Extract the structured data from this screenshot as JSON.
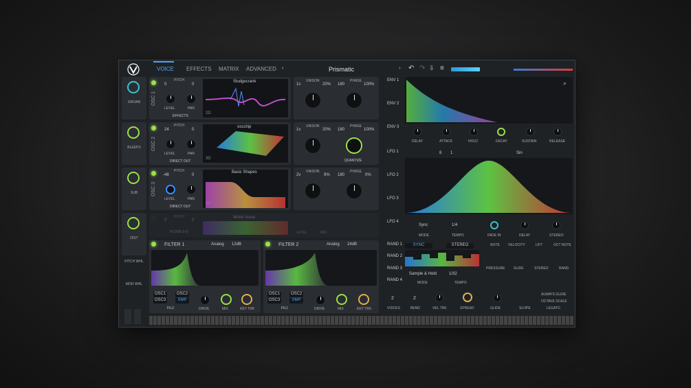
{
  "header": {
    "tabs": [
      "VOICE",
      "EFFECTS",
      "MATRIX",
      "ADVANCED"
    ],
    "preset": "Prismatic"
  },
  "sidebar": [
    "GROAN",
    "BLEEPS",
    "SUB",
    "DIST",
    "PITCH WHL",
    "MOD WHL"
  ],
  "osc1": {
    "name": "OSC 1",
    "wave": "Sludgecrank",
    "pitch_l": "0",
    "pitch_r": "0",
    "dest": "EFFECTS",
    "dim": "2D",
    "voices": "1v",
    "unison_pct": "20%",
    "phase_val": "180",
    "phase_pct": "100%"
  },
  "osc2": {
    "name": "OSC 2",
    "wave": "oscchip",
    "pitch_l": "24",
    "pitch_r": "0",
    "dest": "DIRECT OUT",
    "dim": "3D",
    "voices": "1v",
    "unison_pct": "20%",
    "phase_val": "180",
    "phase_pct": "100%",
    "extra": "QUANTIZE"
  },
  "osc3": {
    "name": "OSC 3",
    "wave": "Basic Shapes",
    "pitch_l": "-48",
    "pitch_r": "0",
    "dest": "DIRECT OUT",
    "dim": "2D",
    "voices": "2v",
    "unison_pct": "9%",
    "phase_val": "180",
    "phase_pct": "0%"
  },
  "smp": {
    "name": "SMP",
    "wave": "White Noise",
    "pitch_l": "0",
    "pitch_r": "0",
    "dest": "FILTER 1+2"
  },
  "labels": {
    "pitch": "PITCH",
    "level": "LEVEL",
    "pan": "PAN",
    "unison": "UNISON",
    "phase": "PHASE"
  },
  "filter1": {
    "title": "FILTER 1",
    "model": "Analog",
    "slope": "12dB",
    "src": [
      "OSC1",
      "OSC2",
      "OSC3",
      "SMP"
    ],
    "route": "FIL2"
  },
  "filter2": {
    "title": "FILTER 2",
    "model": "Analog",
    "slope": "24dB",
    "src": [
      "OSC1",
      "OSC2",
      "OSC3",
      "SMP"
    ],
    "route": "FIL1"
  },
  "filterKnobs": [
    "DRIVE",
    "MIX",
    "KEY TRK"
  ],
  "env": {
    "tabs": [
      "ENV 1",
      "ENV 2",
      "ENV 3"
    ],
    "knobs": [
      "DELAY",
      "ATTACK",
      "HOLD",
      "DECAY",
      "SUSTAIN",
      "RELEASE"
    ]
  },
  "lfo": {
    "tabs": [
      "LFO 1",
      "LFO 2",
      "LFO 3",
      "LFO 4"
    ],
    "grid_x": "8",
    "grid_y": "1",
    "shape": "Sin",
    "mode": "Sync",
    "tempo": "1/4",
    "knobs": [
      "MODE",
      "TEMPO",
      "FADE IN",
      "DELAY",
      "STEREO"
    ]
  },
  "rand": {
    "tabs": [
      "RAND 1",
      "RAND 2",
      "RAND 3",
      "RAND 4"
    ],
    "sync": "SYNC",
    "stereo": "STEREO",
    "mode": "Sample & Hold",
    "tempo": "1/32",
    "labels": [
      "MODE",
      "TEMPO"
    ]
  },
  "mod": {
    "cols": [
      "NOTE",
      "VELOCITY",
      "LIFT",
      "OCT NOTE"
    ],
    "labels": [
      "PRESSURE",
      "SLIDE",
      "STEREO",
      "RAND"
    ]
  },
  "voice": {
    "voices": "2",
    "bend": "2",
    "labels": [
      "VOICES",
      "BEND",
      "VEL TRK",
      "SPREAD",
      "GLIDE",
      "SLOPE"
    ],
    "opts": [
      "ALWAYS GLIDE",
      "OCTAVE SCALE",
      "LEGATO"
    ]
  }
}
